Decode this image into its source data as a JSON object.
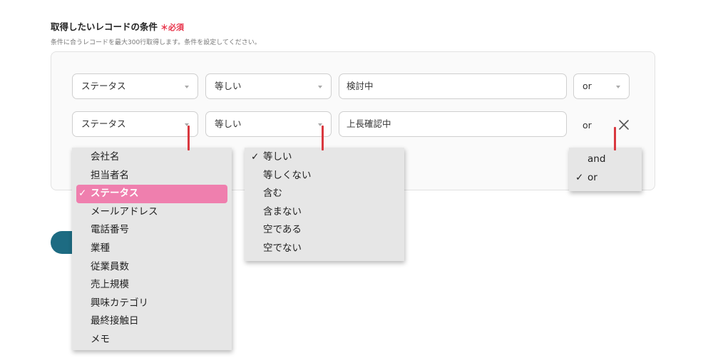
{
  "section": {
    "title": "取得したいレコードの条件",
    "required": "＊必須",
    "description": "条件に合うレコードを最大300行取得します。条件を設定してください。"
  },
  "row1": {
    "field": "ステータス",
    "operator": "等しい",
    "value": "検討中",
    "logic": "or"
  },
  "row2": {
    "field": "ステータス",
    "operator": "等しい",
    "value": "上長確認中",
    "logic": "or"
  },
  "field_menu": {
    "items": [
      "会社名",
      "担当者名",
      "ステータス",
      "メールアドレス",
      "電話番号",
      "業種",
      "従業員数",
      "売上規模",
      "興味カテゴリ",
      "最終接触日",
      "メモ"
    ],
    "selected": "ステータス"
  },
  "operator_menu": {
    "items": [
      "等しい",
      "等しくない",
      "含む",
      "含まない",
      "空である",
      "空でない"
    ],
    "selected": "等しい"
  },
  "logic_menu": {
    "items": [
      "and",
      "or"
    ],
    "selected": "or"
  },
  "colors": {
    "accent": "#ef7fae",
    "required": "#e8334a",
    "button": "#1d6b82",
    "marker": "#d9383f"
  }
}
